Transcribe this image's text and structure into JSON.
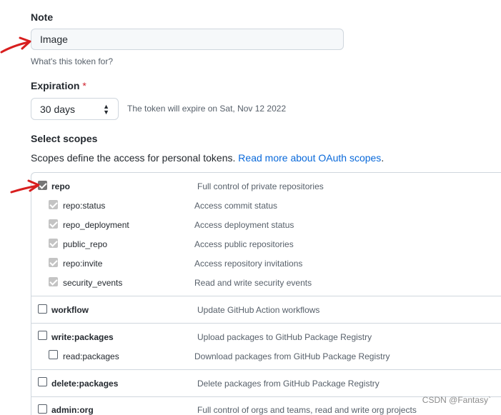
{
  "note": {
    "label": "Note",
    "value": "Image",
    "hint": "What's this token for?"
  },
  "expiration": {
    "label": "Expiration",
    "required_mark": "*",
    "selected": "30 days",
    "info": "The token will expire on Sat, Nov 12 2022"
  },
  "scopes": {
    "heading": "Select scopes",
    "description": "Scopes define the access for personal tokens.",
    "link_text": "Read more about OAuth scopes",
    "link_suffix": ".",
    "rows": [
      {
        "name": "repo",
        "desc": "Full control of private repositories",
        "checked": true
      },
      {
        "name": "repo:status",
        "desc": "Access commit status",
        "checked": true
      },
      {
        "name": "repo_deployment",
        "desc": "Access deployment status",
        "checked": true
      },
      {
        "name": "public_repo",
        "desc": "Access public repositories",
        "checked": true
      },
      {
        "name": "repo:invite",
        "desc": "Access repository invitations",
        "checked": true
      },
      {
        "name": "security_events",
        "desc": "Read and write security events",
        "checked": true
      },
      {
        "name": "workflow",
        "desc": "Update GitHub Action workflows",
        "checked": false
      },
      {
        "name": "write:packages",
        "desc": "Upload packages to GitHub Package Registry",
        "checked": false
      },
      {
        "name": "read:packages",
        "desc": "Download packages from GitHub Package Registry",
        "checked": false
      },
      {
        "name": "delete:packages",
        "desc": "Delete packages from GitHub Package Registry",
        "checked": false
      },
      {
        "name": "admin:org",
        "desc": "Full control of orgs and teams, read and write org projects",
        "checked": false
      }
    ]
  },
  "annotation_color": "#d81e1e",
  "watermark": "CSDN @Fantasy`"
}
